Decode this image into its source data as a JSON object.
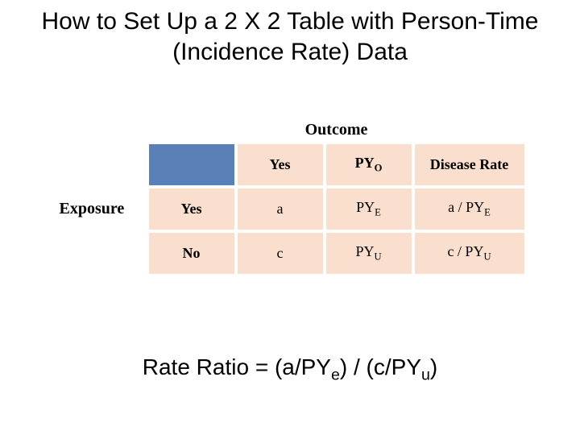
{
  "title": "How to Set Up a 2 X 2 Table with Person-Time (Incidence Rate) Data",
  "labels": {
    "outcome": "Outcome",
    "exposure": "Exposure"
  },
  "table": {
    "header": {
      "c1": "",
      "c2": "Yes",
      "c3_base": "PY",
      "c3_sub": "O",
      "c4": "Disease Rate"
    },
    "row_yes": {
      "c1": "Yes",
      "c2": "a",
      "c3_base": "PY",
      "c3_sub": "E",
      "c4_pre": "a / PY",
      "c4_sub": "E"
    },
    "row_no": {
      "c1": "No",
      "c2": "c",
      "c3_base": "PY",
      "c3_sub": "U",
      "c4_pre": "c / PY",
      "c4_sub": "U"
    }
  },
  "formula": {
    "lead": "Rate Ratio = (a/PY",
    "sub1": "e",
    "mid": ") / (c/PY",
    "sub2": "u",
    "tail": ")"
  }
}
